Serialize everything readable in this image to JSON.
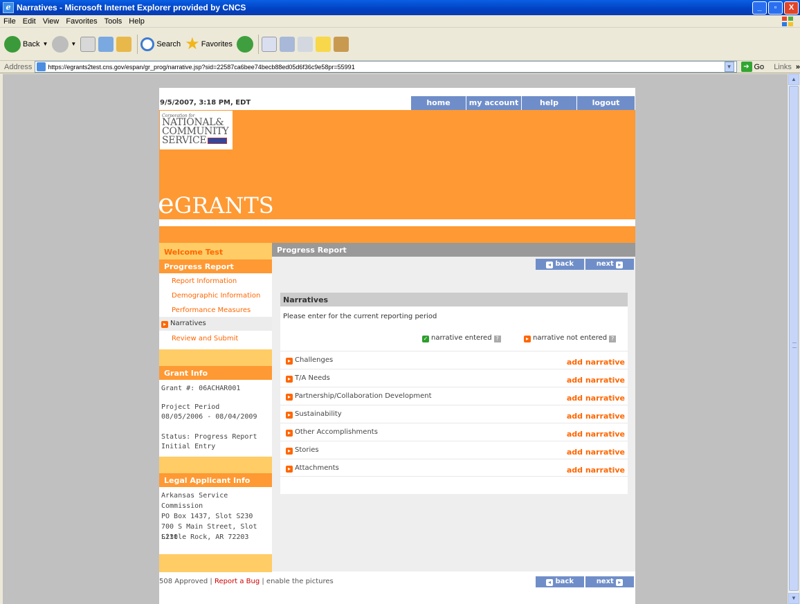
{
  "window": {
    "title": "Narratives - Microsoft Internet Explorer provided by CNCS",
    "buttons": [
      "_",
      "▫",
      "X"
    ]
  },
  "menu": [
    "File",
    "Edit",
    "View",
    "Favorites",
    "Tools",
    "Help"
  ],
  "toolbar": {
    "back": "Back",
    "search": "Search",
    "favorites": "Favorites"
  },
  "address": {
    "label": "Address",
    "url": "https://egrants2test.cns.gov/espan/gr_prog/narrative.jsp?sid=22587ca6bee74becb88ed05d6f36c9e58pr=55991",
    "go": "Go",
    "links": "Links"
  },
  "page": {
    "datestamp": "9/5/2007, 3:18 PM, EDT",
    "topnav": [
      "home",
      "my account",
      "help",
      "logout"
    ],
    "logo": {
      "small": "Corporation for",
      "line1": "NATIONAL&",
      "line2": "COMMUNITY",
      "line3": "SERVICE"
    },
    "brand_first": "e",
    "brand_rest": "GRANTS"
  },
  "sidebar": {
    "welcome": "Welcome Test",
    "progress_head": "Progress Report",
    "links": [
      "Report Information",
      "Demographic Information",
      "Performance Measures"
    ],
    "current": "Narratives",
    "review": "Review and Submit",
    "grant_head": "Grant Info",
    "grant_number": "Grant #: 06ACHAR001",
    "project_period_label": "Project Period",
    "project_period": "08/05/2006 - 08/04/2009",
    "status_line1": "Status: Progress Report",
    "status_line2": "Initial Entry",
    "legal_head": "Legal Applicant Info",
    "legal_lines": [
      "Arkansas Service",
      "Commission",
      "PO Box 1437, Slot S230",
      "700 S Main Street, Slot S230",
      "Little Rock, AR 72203"
    ]
  },
  "main": {
    "heading": "Progress Report",
    "back": "back",
    "next": "next",
    "narratives_head": "Narratives",
    "instruction": "Please enter for the current reporting period",
    "legend_entered": "narrative entered",
    "legend_not_entered": "narrative not entered",
    "rows": [
      {
        "label": "Challenges",
        "action": "add narrative"
      },
      {
        "label": "T/A Needs",
        "action": "add narrative"
      },
      {
        "label": "Partnership/Collaboration Development",
        "action": "add narrative"
      },
      {
        "label": "Sustainability",
        "action": "add narrative"
      },
      {
        "label": "Other Accomplishments",
        "action": "add narrative"
      },
      {
        "label": "Stories",
        "action": "add narrative"
      },
      {
        "label": "Attachments",
        "action": "add narrative"
      }
    ]
  },
  "footer": {
    "approved": "508 Approved",
    "sep": "|",
    "bug": "Report a Bug",
    "pictures": "enable the pictures"
  },
  "colors": {
    "brand_orange": "#ff9933",
    "accent_orange": "#ff6600",
    "nav_blue": "#6f8ec9"
  }
}
